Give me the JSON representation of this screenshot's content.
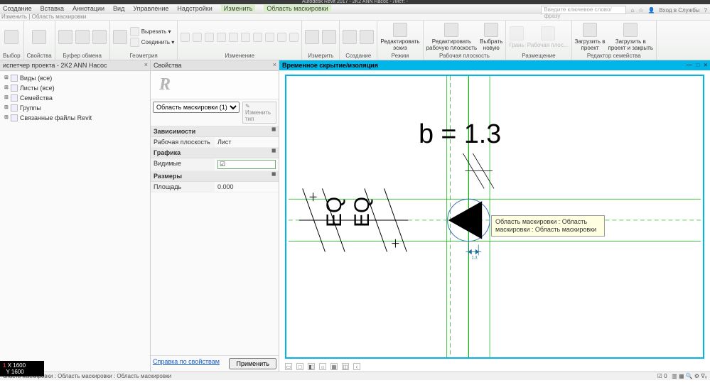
{
  "titlebar": "Autodesk Revit 2017 - 2K2 ANN Насос - Лист: -",
  "search_placeholder": "Введите ключевое слово/фразу",
  "user_label": "Вход в Службы",
  "menubar": [
    "Создание",
    "Вставка",
    "Аннотации",
    "Вид",
    "Управление",
    "Надстройки",
    "Изменить",
    "Область маскировки"
  ],
  "ribbontab": "Изменить | Область маскировки",
  "ribbon_groups": [
    {
      "label": "Выбор",
      "items": 1
    },
    {
      "label": "Свойства",
      "items": 1
    },
    {
      "label": "Буфер обмена",
      "items": 3
    },
    {
      "label": "Геометрия",
      "items": 3,
      "rows": [
        {
          "txt": "Вырезать"
        },
        {
          "txt": "Соединить"
        }
      ]
    },
    {
      "label": "Изменение",
      "items": 10
    },
    {
      "label": "Измерить",
      "items": 2
    },
    {
      "label": "Создание",
      "items": 2
    },
    {
      "label": "Режим",
      "btns": [
        {
          "t": "Редактировать",
          "s": "эскиз"
        }
      ]
    },
    {
      "label": "Рабочая плоскость",
      "btns": [
        {
          "t": "Редактировать",
          "s": "рабочую плоскость"
        },
        {
          "t": "Выбрать",
          "s": "новую"
        }
      ]
    },
    {
      "label": "Размещение",
      "btns": [
        {
          "t": "Грань",
          "s": ""
        },
        {
          "t": "Рабочая плос...",
          "s": ""
        }
      ],
      "dim": true
    },
    {
      "label": "Редактор семейства",
      "btns": [
        {
          "t": "Загрузить в",
          "s": "проект"
        },
        {
          "t": "Загрузить в",
          "s": "проект и закрыть"
        }
      ]
    }
  ],
  "browser": {
    "title": "испетчер проекта - 2K2 ANN Насос",
    "items": [
      {
        "label": "Виды (все)"
      },
      {
        "label": "Листы (все)"
      },
      {
        "label": "Семейства"
      },
      {
        "label": "Группы"
      },
      {
        "label": "Связанные файлы Revit"
      }
    ]
  },
  "props": {
    "title": "Свойства",
    "selector": "Область маскировки (1)",
    "edit_type": "Изменить тип",
    "sections": [
      {
        "header": "Зависимости",
        "rows": [
          {
            "k": "Рабочая плоскость",
            "v": "Лист"
          }
        ]
      },
      {
        "header": "Графика",
        "rows": [
          {
            "k": "Видимые",
            "v": "checkbox"
          }
        ]
      },
      {
        "header": "Размеры",
        "rows": [
          {
            "k": "Площадь",
            "v": "0.000"
          }
        ]
      }
    ],
    "help_link": "Справка по свойствам",
    "apply": "Применить"
  },
  "canvas": {
    "title": "Временное скрытие/изоляция",
    "formula": "b = 1.3",
    "eq": "EQ",
    "dim": "1.3",
    "tooltip": "Область маскировки : Область маскировки : Область маскировки"
  },
  "coords": {
    "x": "X 1600",
    "y": "Y 1600",
    "tag": "1"
  },
  "statusbar": "бласть маскировки : Область маскировки : Область маскировки",
  "statusbar_right": "0"
}
